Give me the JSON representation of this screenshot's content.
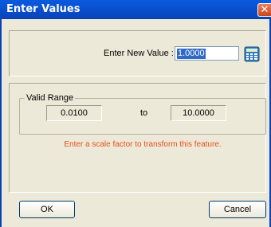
{
  "dialog": {
    "title": "Enter Values",
    "close_glyph": "✕"
  },
  "new_value": {
    "label": "Enter New Value :",
    "value": "1.0000",
    "calculator_icon": "calculator-icon"
  },
  "range": {
    "label": "Valid Range",
    "min": "0.0100",
    "separator": "to",
    "max": "10.0000"
  },
  "hint": "Enter a scale factor to transform this feature.",
  "buttons": {
    "ok": "OK",
    "cancel": "Cancel"
  },
  "colors": {
    "title_bar": "#0a5be0",
    "hint_text": "#e8501a",
    "selection": "#316ac5"
  }
}
